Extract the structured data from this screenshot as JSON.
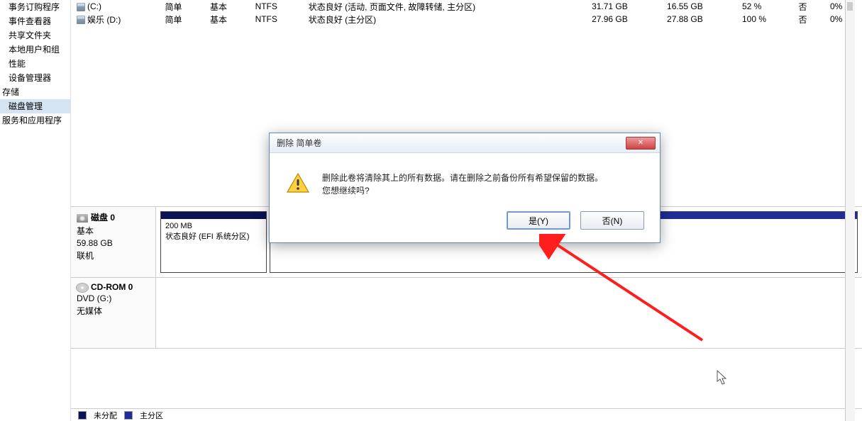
{
  "sidebar": {
    "items": [
      {
        "label": "事务订购程序"
      },
      {
        "label": "事件查看器"
      },
      {
        "label": "共享文件夹"
      },
      {
        "label": "本地用户和组"
      },
      {
        "label": "性能"
      },
      {
        "label": "设备管理器"
      },
      {
        "label": "存储"
      },
      {
        "label": "磁盘管理"
      },
      {
        "label": "服务和应用程序"
      }
    ],
    "selected_index": 7
  },
  "volumes": {
    "rows": [
      {
        "icon": "vol",
        "name": "(C:)",
        "layout": "简单",
        "type": "基本",
        "fs": "NTFS",
        "status": "状态良好 (活动, 页面文件, 故障转储, 主分区)",
        "cap": "31.71 GB",
        "free": "16.55 GB",
        "freepct": "52 %",
        "ft": "否",
        "oh": "0%"
      },
      {
        "icon": "vol",
        "name": "娱乐 (D:)",
        "layout": "简单",
        "type": "基本",
        "fs": "NTFS",
        "status": "状态良好 (主分区)",
        "cap": "27.96 GB",
        "free": "27.88 GB",
        "freepct": "100 %",
        "ft": "否",
        "oh": "0%"
      }
    ]
  },
  "disk0": {
    "title": "磁盘 0",
    "line1": "基本",
    "line2": "59.88 GB",
    "line3": "联机",
    "part0": {
      "name": "",
      "size": "200 MB",
      "status": "状态良好 (EFI 系统分区)"
    }
  },
  "cdrom": {
    "title": "CD-ROM 0",
    "line1": "DVD (G:)",
    "line2": "",
    "line3": "无媒体"
  },
  "legend": {
    "a": "未分配",
    "b": "主分区"
  },
  "dialog": {
    "title": "删除 简单卷",
    "message_l1": "删除此卷将清除其上的所有数据。请在删除之前备份所有希望保留的数据。",
    "message_l2": "您想继续吗?",
    "yes": "是(Y)",
    "no": "否(N)"
  }
}
